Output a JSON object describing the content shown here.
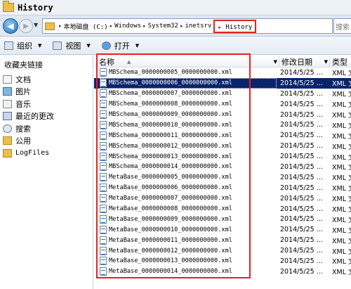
{
  "window": {
    "title": "History"
  },
  "address": {
    "crumbs": [
      "本地磁盘 (C:)",
      "Windows",
      "System32",
      "inetsrv"
    ],
    "current": "History",
    "search_placeholder": "搜索"
  },
  "toolbar": {
    "organize": "组织",
    "views": "视图",
    "open": "打开"
  },
  "nav": {
    "favorites_header": "收藏夹链接",
    "items": [
      "文档",
      "图片",
      "音乐",
      "最近的更改",
      "搜索",
      "公用",
      "LogFiles"
    ]
  },
  "columns": {
    "name": "名称",
    "date": "修改日期",
    "type": "类型"
  },
  "files": [
    {
      "name": "MBSchema_0000000005_0000000000.xml",
      "date": "2014/5/25 ...",
      "type": "XML 文",
      "selected": false
    },
    {
      "name": "MBSchema_0000000006_0000000000.xml",
      "date": "2014/5/25 ...",
      "type": "XML 文",
      "selected": true
    },
    {
      "name": "MBSchema_0000000007_0000000000.xml",
      "date": "2014/5/25 ...",
      "type": "XML 文",
      "selected": false
    },
    {
      "name": "MBSchema_0000000008_0000000000.xml",
      "date": "2014/5/25 ...",
      "type": "XML 文",
      "selected": false
    },
    {
      "name": "MBSchema_0000000009_0000000000.xml",
      "date": "2014/5/25 ...",
      "type": "XML 文",
      "selected": false
    },
    {
      "name": "MBSchema_0000000010_0000000000.xml",
      "date": "2014/5/25 ...",
      "type": "XML 文",
      "selected": false
    },
    {
      "name": "MBSchema_0000000011_0000000000.xml",
      "date": "2014/5/25 ...",
      "type": "XML 文",
      "selected": false
    },
    {
      "name": "MBSchema_0000000012_0000000000.xml",
      "date": "2014/5/25 ...",
      "type": "XML 文",
      "selected": false
    },
    {
      "name": "MBSchema_0000000013_0000000000.xml",
      "date": "2014/5/25 ...",
      "type": "XML 文",
      "selected": false
    },
    {
      "name": "MBSchema_0000000014_0000000000.xml",
      "date": "2014/5/25 ...",
      "type": "XML 文",
      "selected": false
    },
    {
      "name": "MetaBase_0000000005_0000000000.xml",
      "date": "2014/5/25 ...",
      "type": "XML 文",
      "selected": false
    },
    {
      "name": "MetaBase_0000000006_0000000000.xml",
      "date": "2014/5/25 ...",
      "type": "XML 文",
      "selected": false
    },
    {
      "name": "MetaBase_0000000007_0000000000.xml",
      "date": "2014/5/25 ...",
      "type": "XML 文",
      "selected": false
    },
    {
      "name": "MetaBase_0000000008_0000000000.xml",
      "date": "2014/5/25 ...",
      "type": "XML 文",
      "selected": false
    },
    {
      "name": "MetaBase_0000000009_0000000000.xml",
      "date": "2014/5/25 ...",
      "type": "XML 文",
      "selected": false
    },
    {
      "name": "MetaBase_0000000010_0000000000.xml",
      "date": "2014/5/25 ...",
      "type": "XML 文",
      "selected": false
    },
    {
      "name": "MetaBase_0000000011_0000000000.xml",
      "date": "2014/5/25 ...",
      "type": "XML 文",
      "selected": false
    },
    {
      "name": "MetaBase_0000000012_0000000000.xml",
      "date": "2014/5/25 ...",
      "type": "XML 文",
      "selected": false
    },
    {
      "name": "MetaBase_0000000013_0000000000.xml",
      "date": "2014/5/25 ...",
      "type": "XML 文",
      "selected": false
    },
    {
      "name": "MetaBase_0000000014_0000000000.xml",
      "date": "2014/5/25 ...",
      "type": "XML 文",
      "selected": false
    }
  ],
  "colors": {
    "selection": "#0a246a",
    "highlight_box": "#e8211f"
  }
}
